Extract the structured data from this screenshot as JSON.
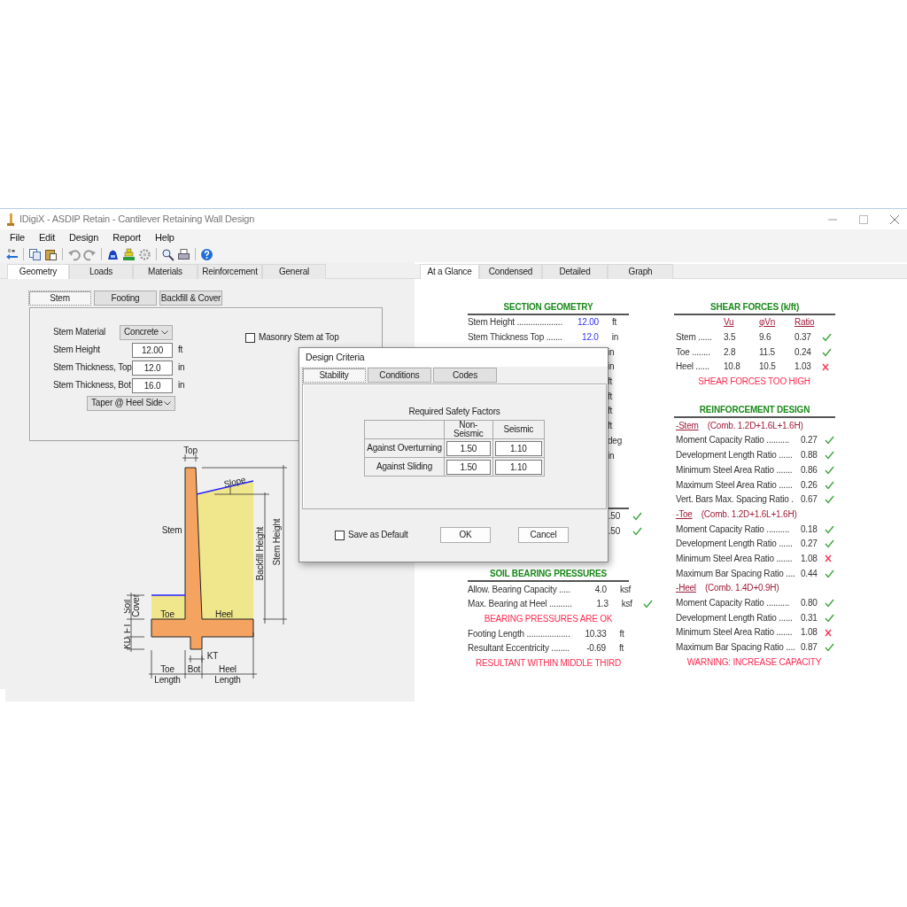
{
  "window": {
    "title": "IDigiX - ASDIP Retain - Cantilever Retaining Wall Design"
  },
  "menu": [
    "File",
    "Edit",
    "Design",
    "Report",
    "Help"
  ],
  "input_tabs": [
    {
      "label": "Geometry",
      "selected": true
    },
    {
      "label": "Loads",
      "selected": false
    },
    {
      "label": "Materials",
      "selected": false
    },
    {
      "label": "Reinforcement",
      "selected": false
    },
    {
      "label": "General",
      "selected": false
    }
  ],
  "geometry_tabs": [
    {
      "label": "Stem",
      "selected": true
    },
    {
      "label": "Footing",
      "selected": false
    },
    {
      "label": "Backfill & Cover",
      "selected": false
    }
  ],
  "stem_form": {
    "material": {
      "label": "Stem Material",
      "value": "Concrete"
    },
    "fields": [
      {
        "label": "Stem Height",
        "value": "12.00",
        "unit": "ft"
      },
      {
        "label": "Stem Thickness, Top",
        "value": "12.0",
        "unit": "in"
      },
      {
        "label": "Stem Thickness, Bot",
        "value": "16.0",
        "unit": "in"
      }
    ],
    "taper": "Taper @ Heel Side",
    "masonry": {
      "label": "Masonry Stem at Top",
      "checked": false
    }
  },
  "diagram": {
    "top": "Top",
    "slope": "Slope",
    "stem": "Stem",
    "backfill_height": "Backfill Height",
    "stem_height": "Stem Height",
    "soil": "Soil",
    "cover": "Cover",
    "ft": "FT",
    "kd": "KD",
    "toe": "Toe",
    "heel": "Heel",
    "kt": "KT",
    "toe_length": [
      "Toe",
      "Length"
    ],
    "bot": "Bot",
    "heel_length": [
      "Heel",
      "Length"
    ]
  },
  "results_tabs": [
    {
      "label": "At a Glance",
      "selected": true
    },
    {
      "label": "Condensed",
      "selected": false
    },
    {
      "label": "Detailed",
      "selected": false
    },
    {
      "label": "Graph",
      "selected": false
    }
  ],
  "section_geometry": {
    "title": "SECTION GEOMETRY",
    "rows": [
      {
        "label": "Stem Height ....................",
        "value": "12.00",
        "unit": "ft",
        "input": true
      },
      {
        "label": "Stem Thickness Top .......",
        "value": "12.0",
        "unit": "in",
        "input": true
      },
      {
        "unit": "in"
      },
      {
        "unit": "in"
      },
      {
        "unit": "ft"
      },
      {
        "unit": "ft"
      },
      {
        "unit": "ft"
      },
      {
        "unit": "ft"
      },
      {
        "unit": "deg"
      },
      {
        "unit": "in"
      }
    ]
  },
  "stability": {
    "rows": [
      {
        "value": ".50",
        "passed": true
      },
      {
        "value": ".50",
        "passed": true
      }
    ]
  },
  "soil_bearing": {
    "title": "SOIL BEARING PRESSURES",
    "items": [
      {
        "kind": "row",
        "label": "Allow. Bearing Capacity .....",
        "value": "4.0",
        "unit": "ksf",
        "input": false
      },
      {
        "kind": "row",
        "label": "Max. Bearing at Heel ..........",
        "value": "1.3",
        "unit": "ksf",
        "input": false,
        "passed": true
      },
      {
        "kind": "message",
        "text": "BEARING PRESSURES ARE OK"
      },
      {
        "kind": "row",
        "label": "Footing Length ...................",
        "value": "10.33",
        "unit": "ft",
        "input": false
      },
      {
        "kind": "row",
        "label": "Resultant Eccentricity ........",
        "value": "-0.69",
        "unit": "ft",
        "input": false
      },
      {
        "kind": "message",
        "text": "RESULTANT WITHIN MIDDLE THIRD"
      }
    ]
  },
  "shear_forces": {
    "title": "SHEAR FORCES (k/ft)",
    "columns": [
      "Vu",
      "φVn",
      "Ratio"
    ],
    "rows": [
      {
        "label": "Stem ......",
        "vu": "3.5",
        "phi_vn": "9.6",
        "ratio": "0.37",
        "passed": true
      },
      {
        "label": "Toe ........",
        "vu": "2.8",
        "phi_vn": "11.5",
        "ratio": "0.24",
        "passed": true
      },
      {
        "label": "Heel ......",
        "vu": "10.8",
        "phi_vn": "10.5",
        "ratio": "1.03",
        "passed": false
      }
    ],
    "message": "SHEAR FORCES TOO HIGH"
  },
  "reinforcement": {
    "title": "REINFORCEMENT DESIGN",
    "groups": [
      {
        "name": "-Stem",
        "combo": "(Comb. 1.2D+1.6L+1.6H)",
        "rows": [
          {
            "label": "Moment Capacity Ratio ..........",
            "value": "0.27",
            "passed": true
          },
          {
            "label": "Development Length Ratio ......",
            "value": "0.88",
            "passed": true
          },
          {
            "label": "Minimum Steel Area Ratio .......",
            "value": "0.86",
            "passed": true
          },
          {
            "label": "Maximum Steel Area Ratio ......",
            "value": "0.26",
            "passed": true
          },
          {
            "label": "Vert. Bars Max. Spacing Ratio .",
            "value": "0.67",
            "passed": true
          }
        ]
      },
      {
        "name": "-Toe",
        "combo": "(Comb. 1.2D+1.6L+1.6H)",
        "rows": [
          {
            "label": "Moment Capacity Ratio ..........",
            "value": "0.18",
            "passed": true
          },
          {
            "label": "Development Length Ratio ......",
            "value": "0.27",
            "passed": true
          },
          {
            "label": "Minimum Steel Area Ratio .......",
            "value": "1.08",
            "passed": false
          },
          {
            "label": "Maximum Bar Spacing Ratio ....",
            "value": "0.44",
            "passed": true
          }
        ]
      },
      {
        "name": "-Heel",
        "combo": "(Comb. 1.4D+0.9H)",
        "rows": [
          {
            "label": "Moment Capacity Ratio ..........",
            "value": "0.80",
            "passed": true
          },
          {
            "label": "Development Length Ratio ......",
            "value": "0.31",
            "passed": true
          },
          {
            "label": "Minimum Steel Area Ratio .......",
            "value": "1.08",
            "passed": false
          },
          {
            "label": "Maximum Bar Spacing Ratio ....",
            "value": "0.87",
            "passed": true
          }
        ]
      }
    ],
    "message": "WARNING: INCREASE CAPACITY"
  },
  "dialog": {
    "title": "Design Criteria",
    "tabs": [
      {
        "label": "Stability",
        "selected": true
      },
      {
        "label": "Conditions",
        "selected": false
      },
      {
        "label": "Codes",
        "selected": false
      }
    ],
    "caption": "Required Safety Factors",
    "columns": [
      "Non-Seismic",
      "Seismic"
    ],
    "rows": [
      {
        "label": "Against Overturning",
        "values": [
          "1.50",
          "1.10"
        ]
      },
      {
        "label": "Against Sliding",
        "values": [
          "1.50",
          "1.10"
        ]
      }
    ],
    "save_default": {
      "label": "Save as Default",
      "checked": false
    },
    "buttons": [
      "OK",
      "Cancel"
    ]
  }
}
